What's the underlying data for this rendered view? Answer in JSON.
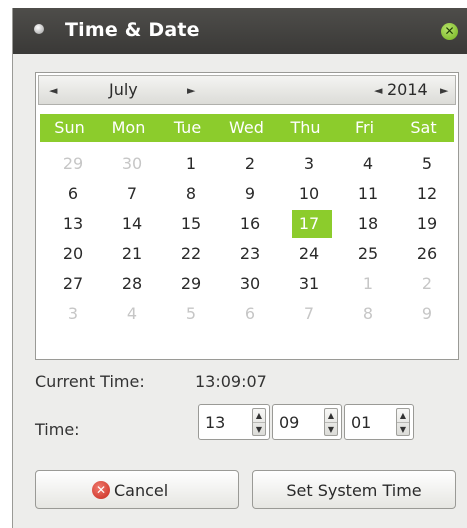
{
  "window": {
    "title": "Time & Date",
    "close_icon": "close-icon"
  },
  "calendar": {
    "month": "July",
    "year": "2014",
    "prev_month_glyph": "◄",
    "next_month_glyph": "►",
    "prev_year_glyph": "◄",
    "next_year_glyph": "►",
    "weekdays": [
      "Sun",
      "Mon",
      "Tue",
      "Wed",
      "Thu",
      "Fri",
      "Sat"
    ],
    "weeks": [
      [
        "29",
        "30",
        "1",
        "2",
        "3",
        "4",
        "5"
      ],
      [
        "6",
        "7",
        "8",
        "9",
        "10",
        "11",
        "12"
      ],
      [
        "13",
        "14",
        "15",
        "16",
        "17",
        "18",
        "19"
      ],
      [
        "20",
        "21",
        "22",
        "23",
        "24",
        "25",
        "26"
      ],
      [
        "27",
        "28",
        "29",
        "30",
        "31",
        "1",
        "2"
      ],
      [
        "3",
        "4",
        "5",
        "6",
        "7",
        "8",
        "9"
      ]
    ],
    "selected_day": "17",
    "accent_color": "#8ccc2c"
  },
  "current_time": {
    "label": "Current Time:",
    "value": "13:09:07"
  },
  "time_setter": {
    "label": "Time:",
    "hours": "13",
    "minutes": "09",
    "seconds": "01",
    "up_glyph": "▲",
    "down_glyph": "▼"
  },
  "buttons": {
    "cancel_label": "Cancel",
    "cancel_icon_glyph": "✕",
    "set_label": "Set System Time"
  }
}
